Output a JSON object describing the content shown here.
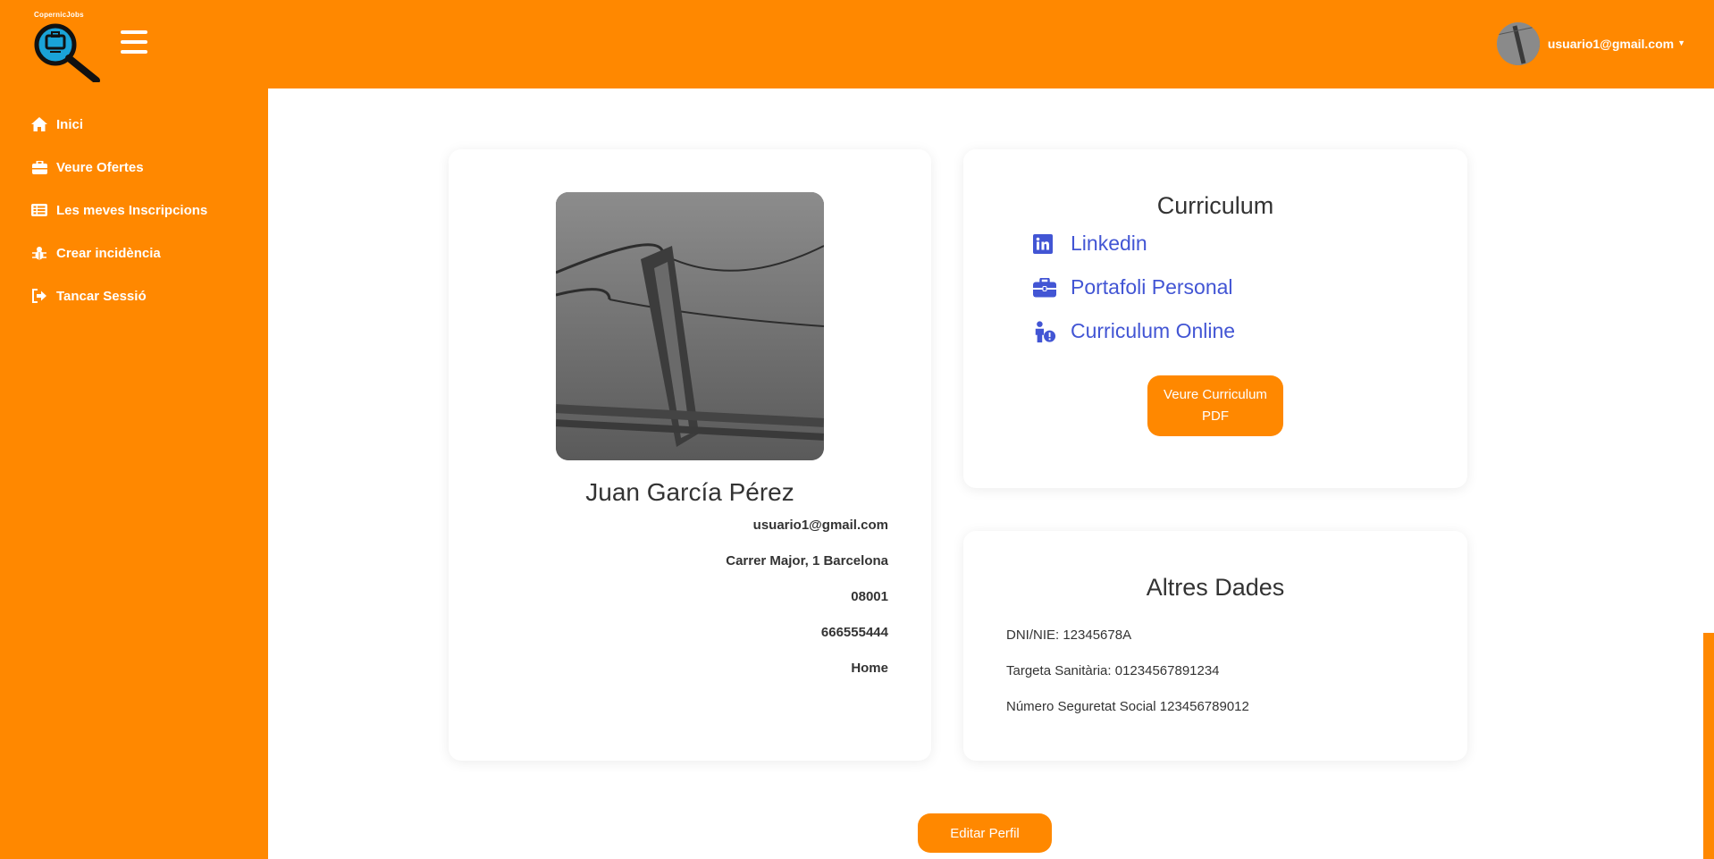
{
  "brand": {
    "logo_text": "CopernicJobs"
  },
  "header": {
    "user_email": "usuario1@gmail.com"
  },
  "sidebar": {
    "items": [
      {
        "label": "Inici",
        "icon": "home-icon"
      },
      {
        "label": "Veure Ofertes",
        "icon": "briefcase-icon"
      },
      {
        "label": "Les meves Inscripcions",
        "icon": "list-icon"
      },
      {
        "label": "Crear incidència",
        "icon": "bug-icon"
      },
      {
        "label": "Tancar Sessió",
        "icon": "logout-icon"
      }
    ]
  },
  "profile": {
    "name": "Juan García Pérez",
    "email": "usuario1@gmail.com",
    "address": "Carrer Major, 1 Barcelona",
    "postal_code": "08001",
    "phone": "666555444",
    "label": "Home"
  },
  "curriculum": {
    "title": "Curriculum",
    "links": [
      {
        "label": "Linkedin",
        "icon": "linkedin-icon"
      },
      {
        "label": "Portafoli Personal",
        "icon": "briefcase-icon"
      },
      {
        "label": "Curriculum Online",
        "icon": "person-info-icon"
      }
    ],
    "pdf_button": "Veure Curriculum PDF"
  },
  "other_data": {
    "title": "Altres Dades",
    "dni": "DNI/NIE: 12345678A",
    "health_card": "Targeta Sanitària: 01234567891234",
    "social_security": "Número Seguretat Social 123456789012"
  },
  "actions": {
    "edit_profile": "Editar Perfil"
  },
  "colors": {
    "accent": "#ff8800",
    "link": "#4255d4"
  }
}
